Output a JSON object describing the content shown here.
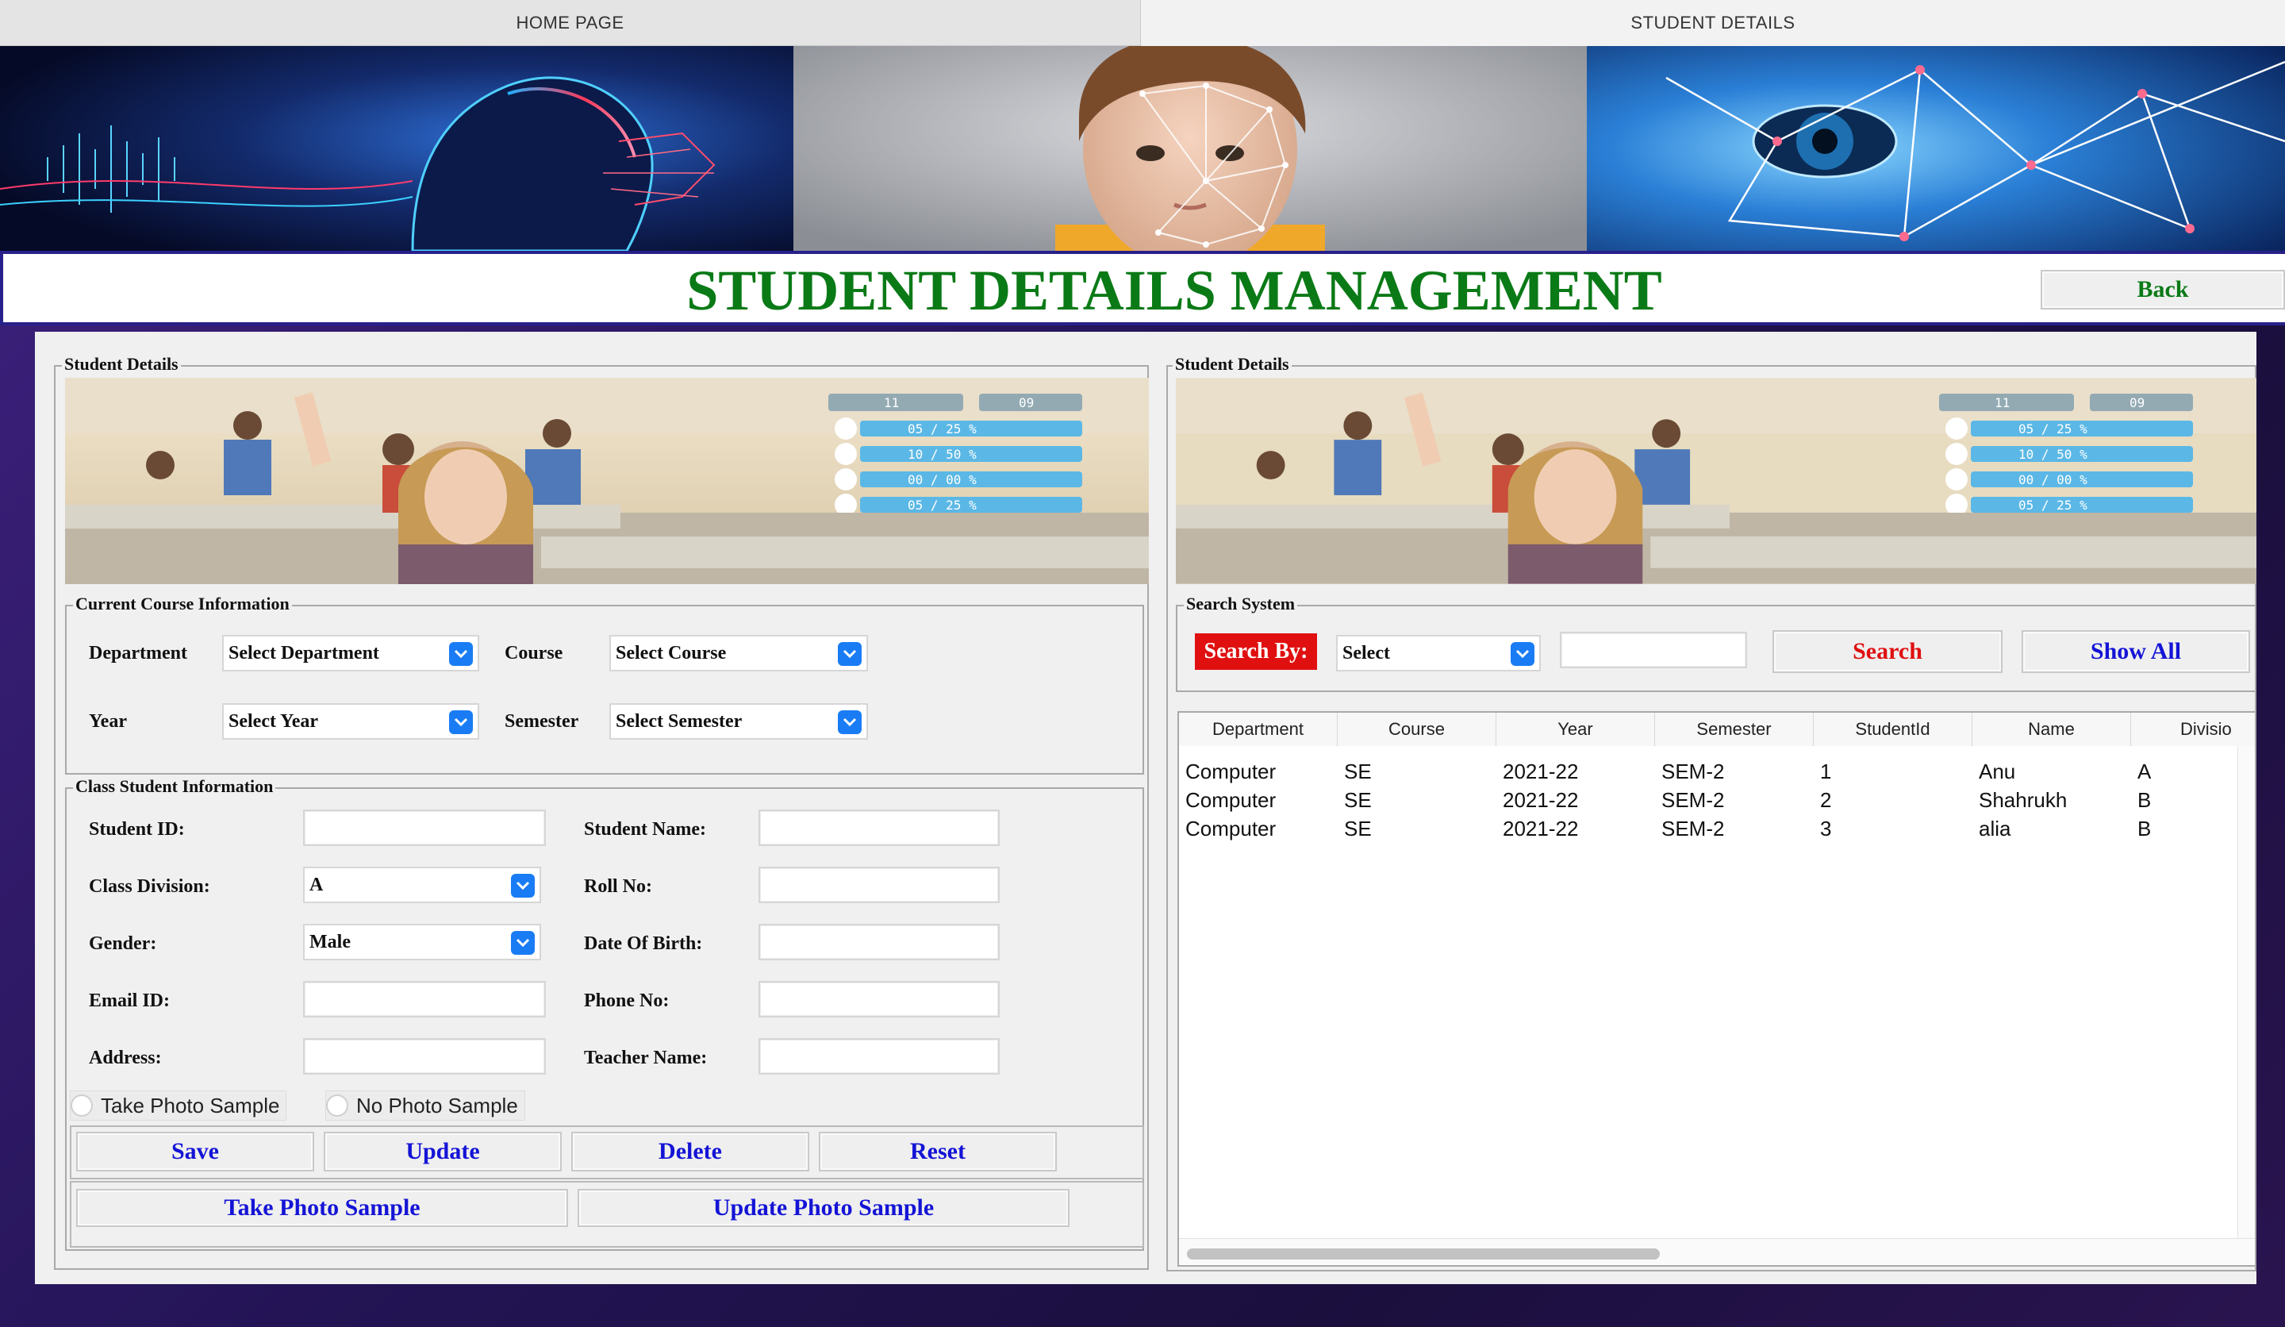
{
  "tabs": {
    "home": "HOME PAGE",
    "details": "STUDENT DETAILS"
  },
  "header": {
    "title": "STUDENT DETAILS MANAGEMENT",
    "back": "Back"
  },
  "left": {
    "frame_title": "Student Details",
    "course_frame": "Current Course Information",
    "course": {
      "department_label": "Department",
      "department_value": "Select Department",
      "course_label": "Course",
      "course_value": "Select Course",
      "year_label": "Year",
      "year_value": "Select Year",
      "semester_label": "Semester",
      "semester_value": "Select Semester"
    },
    "class_frame": "Class Student Information",
    "fields": {
      "student_id": "Student ID:",
      "student_name": "Student Name:",
      "class_division": "Class Division:",
      "class_division_value": "A",
      "roll_no": "Roll No:",
      "gender": "Gender:",
      "gender_value": "Male",
      "dob": "Date Of Birth:",
      "email": "Email ID:",
      "phone": "Phone No:",
      "address": "Address:",
      "teacher": "Teacher Name:"
    },
    "radios": {
      "take": "Take Photo Sample",
      "no": "No Photo Sample"
    },
    "buttons": {
      "save": "Save",
      "update": "Update",
      "delete": "Delete",
      "reset": "Reset",
      "take_photo": "Take Photo Sample",
      "update_photo": "Update Photo Sample"
    }
  },
  "right": {
    "frame_title": "Student Details",
    "search_frame": "Search System",
    "search_by": "Search By:",
    "search_select": "Select",
    "search_value": "",
    "search_button": "Search",
    "show_all_button": "Show All",
    "table": {
      "columns": [
        "Department",
        "Course",
        "Year",
        "Semester",
        "StudentId",
        "Name",
        "Divisio"
      ],
      "rows": [
        [
          "Computer",
          "SE",
          "2021-22",
          "SEM-2",
          "1",
          "Anu",
          "A"
        ],
        [
          "Computer",
          "SE",
          "2021-22",
          "SEM-2",
          "2",
          "Shahrukh",
          "B"
        ],
        [
          "Computer",
          "SE",
          "2021-22",
          "SEM-2",
          "3",
          "alia",
          "B"
        ]
      ]
    }
  },
  "classroom_overlay": {
    "top_left": "11",
    "top_right": "09",
    "rows": [
      "05 / 25 %",
      "10 / 50 %",
      "00 / 00 %",
      "05 / 25 %"
    ]
  },
  "colors": {
    "title_green": "#0a7a16",
    "button_blue": "#1414d6",
    "search_red": "#e01010",
    "chevron_blue": "#1a7cf5",
    "border_navy": "#27208a"
  }
}
